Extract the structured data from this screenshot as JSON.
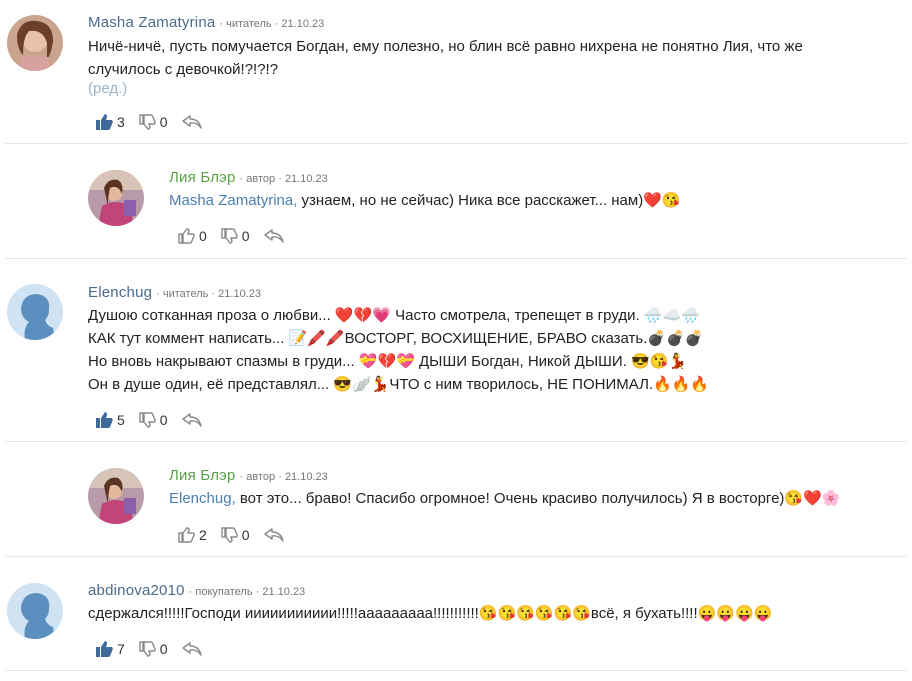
{
  "comments": [
    {
      "author": "Masha Zamatyrina",
      "role": "читатель",
      "date": "21.10.23",
      "lines": [
        "Ничё-ничё, пусть помучается Богдан, ему полезно, но блин всё равно нихрена не понятно Лия, что же",
        "случилось с девочкой!?!?!?"
      ],
      "edited": "(ред.)",
      "likes": "3",
      "dislikes": "0"
    },
    {
      "author": "Лия Блэр",
      "role": "автор",
      "date": "21.10.23",
      "mention": "Masha Zamatyrina,",
      "lines": [
        " узнаем, но не сейчас) Ника все расскажет... нам)❤️😘"
      ],
      "likes": "0",
      "dislikes": "0"
    },
    {
      "author": "Elenchug",
      "role": "читатель",
      "date": "21.10.23",
      "lines": [
        "Душою сотканная проза о любви... ❤️💔💗 Часто смотрела, трепещет в груди. 🌧️☁️🌧️",
        "КАК тут коммент написать... 📝🖍️🖍️ВОСТОРГ, ВОСХИЩЕНИЕ, БРАВО сказать.💣💣💣",
        "Но вновь накрывают спазмы в груди... 💝💔💝 ДЫШИ Богдан, Никой ДЫШИ. 😎😘💃",
        "Он в душе один, её представлял... 😎🪽💃ЧТО с ним творилось, НЕ ПОНИМАЛ.🔥🔥🔥"
      ],
      "likes": "5",
      "dislikes": "0"
    },
    {
      "author": "Лия Блэр",
      "role": "автор",
      "date": "21.10.23",
      "mention": "Elenchug,",
      "lines": [
        " вот это... браво! Спасибо огромное! Очень красиво получилось) Я в восторге)😘❤️🌸"
      ],
      "likes": "2",
      "dislikes": "0"
    },
    {
      "author": "abdinova2010",
      "role": "покупатель",
      "date": "21.10.23",
      "lines": [
        "сдержался!!!!!Господи иииииииииии!!!!!ааааааааа!!!!!!!!!!!😘😘😘😘😘😘всё, я бухать!!!!😛😛😛😛"
      ],
      "likes": "7",
      "dislikes": "0"
    }
  ],
  "colors": {
    "reader": "#4a6b8c",
    "author": "#5aa04a",
    "mention": "#4a7fb0",
    "edited": "#9bb3c8",
    "icon": "#3d6a9a",
    "icon_outline": "#888888"
  },
  "icons": {
    "like": "thumb-up-icon",
    "dislike": "thumb-down-icon",
    "reply": "reply-icon"
  }
}
